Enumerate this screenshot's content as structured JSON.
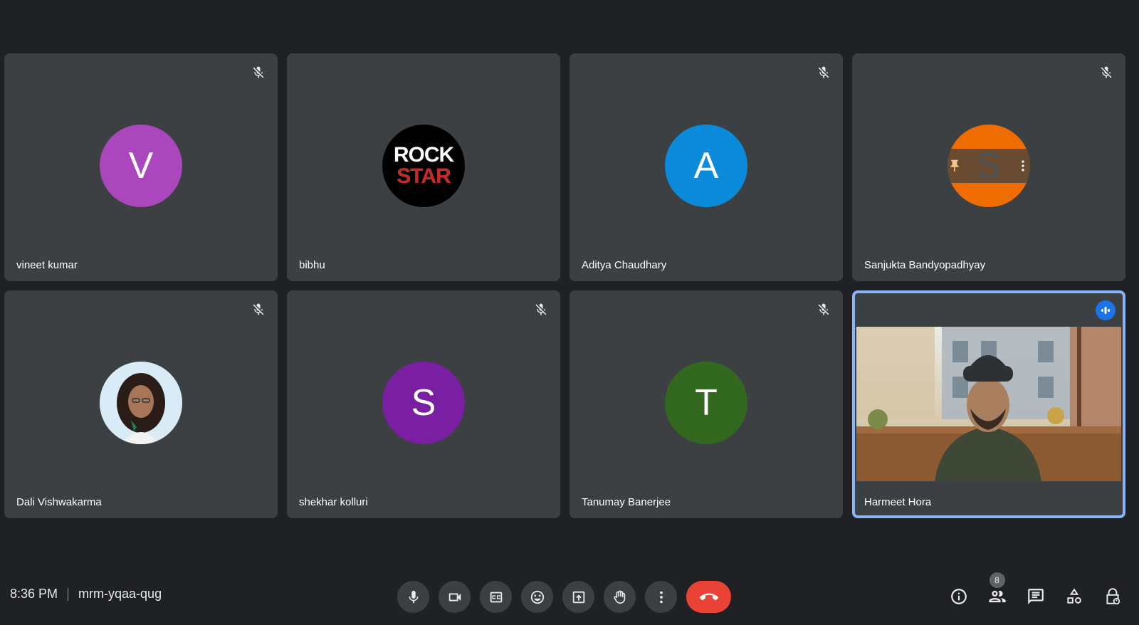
{
  "participants": [
    {
      "name": "vineet kumar",
      "initial": "V",
      "avatar_color": "#ab47bc",
      "muted": true
    },
    {
      "name": "bibhu",
      "avatar_text_top": "ROCK",
      "avatar_text_bottom": "STAR",
      "avatar_color": "#000000",
      "muted": false
    },
    {
      "name": "Aditya Chaudhary",
      "initial": "A",
      "avatar_color": "#0b8bd9",
      "muted": true
    },
    {
      "name": "Sanjukta Bandyopadhyay",
      "initial": "S",
      "avatar_color": "#ef6c00",
      "muted": true,
      "hover_controls": [
        "pin-icon",
        "more-options-icon"
      ]
    },
    {
      "name": "Dali Vishwakarma",
      "avatar": "photo",
      "muted": true
    },
    {
      "name": "shekhar kolluri",
      "initial": "S",
      "avatar_color": "#7b1fa2",
      "muted": true
    },
    {
      "name": "Tanumay Banerjee",
      "initial": "T",
      "avatar_color": "#33691e",
      "muted": true
    },
    {
      "name": "Harmeet Hora",
      "video_on": true,
      "speaking": true,
      "muted": false
    }
  ],
  "meeting": {
    "time": "8:36 PM",
    "code": "mrm-yqaa-qug"
  },
  "controls": [
    "microphone-icon",
    "camera-icon",
    "captions-icon",
    "emoji-icon",
    "present-icon",
    "raise-hand-icon",
    "more-options-icon",
    "end-call-icon"
  ],
  "side_panel": {
    "people_count": "8",
    "icons": [
      "info-icon",
      "people-icon",
      "chat-icon",
      "activities-icon",
      "host-controls-icon"
    ]
  },
  "colors": {
    "background": "#202124",
    "tile": "#3c4043",
    "active_outline": "#8ab4f8",
    "end_call": "#ea4335",
    "speaking": "#1a73e8"
  }
}
